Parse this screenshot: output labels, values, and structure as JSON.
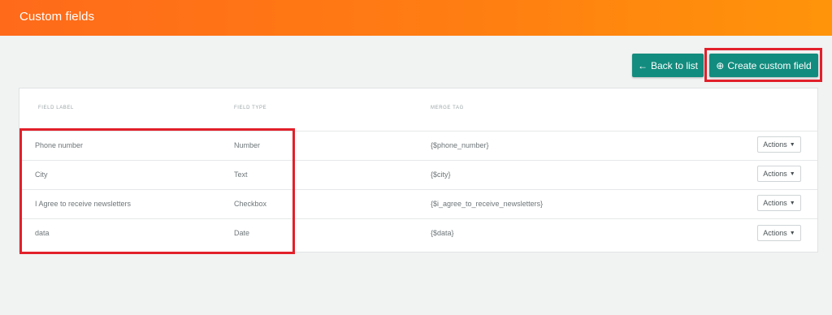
{
  "header": {
    "title": "Custom fields"
  },
  "toolbar": {
    "back_label": "Back to list",
    "back_icon": "arrow-left-icon",
    "create_label": "Create custom field",
    "create_icon": "plus-circle-icon"
  },
  "table": {
    "columns": [
      "FIELD LABEL",
      "FIELD TYPE",
      "MERGE TAG"
    ],
    "rows": [
      {
        "label": "Phone number",
        "type": "Number",
        "tag": "{$phone_number}",
        "action": "Actions"
      },
      {
        "label": "City",
        "type": "Text",
        "tag": "{$city}",
        "action": "Actions"
      },
      {
        "label": "I Agree to receive newsletters",
        "type": "Checkbox",
        "tag": "{$i_agree_to_receive_newsletters}",
        "action": "Actions"
      },
      {
        "label": "data",
        "type": "Date",
        "tag": "{$data}",
        "action": "Actions"
      }
    ]
  },
  "colors": {
    "header_gradient_start": "#ff6a1a",
    "header_gradient_end": "#ff940a",
    "button_teal": "#128c7e",
    "highlight_red": "#e2202a"
  }
}
